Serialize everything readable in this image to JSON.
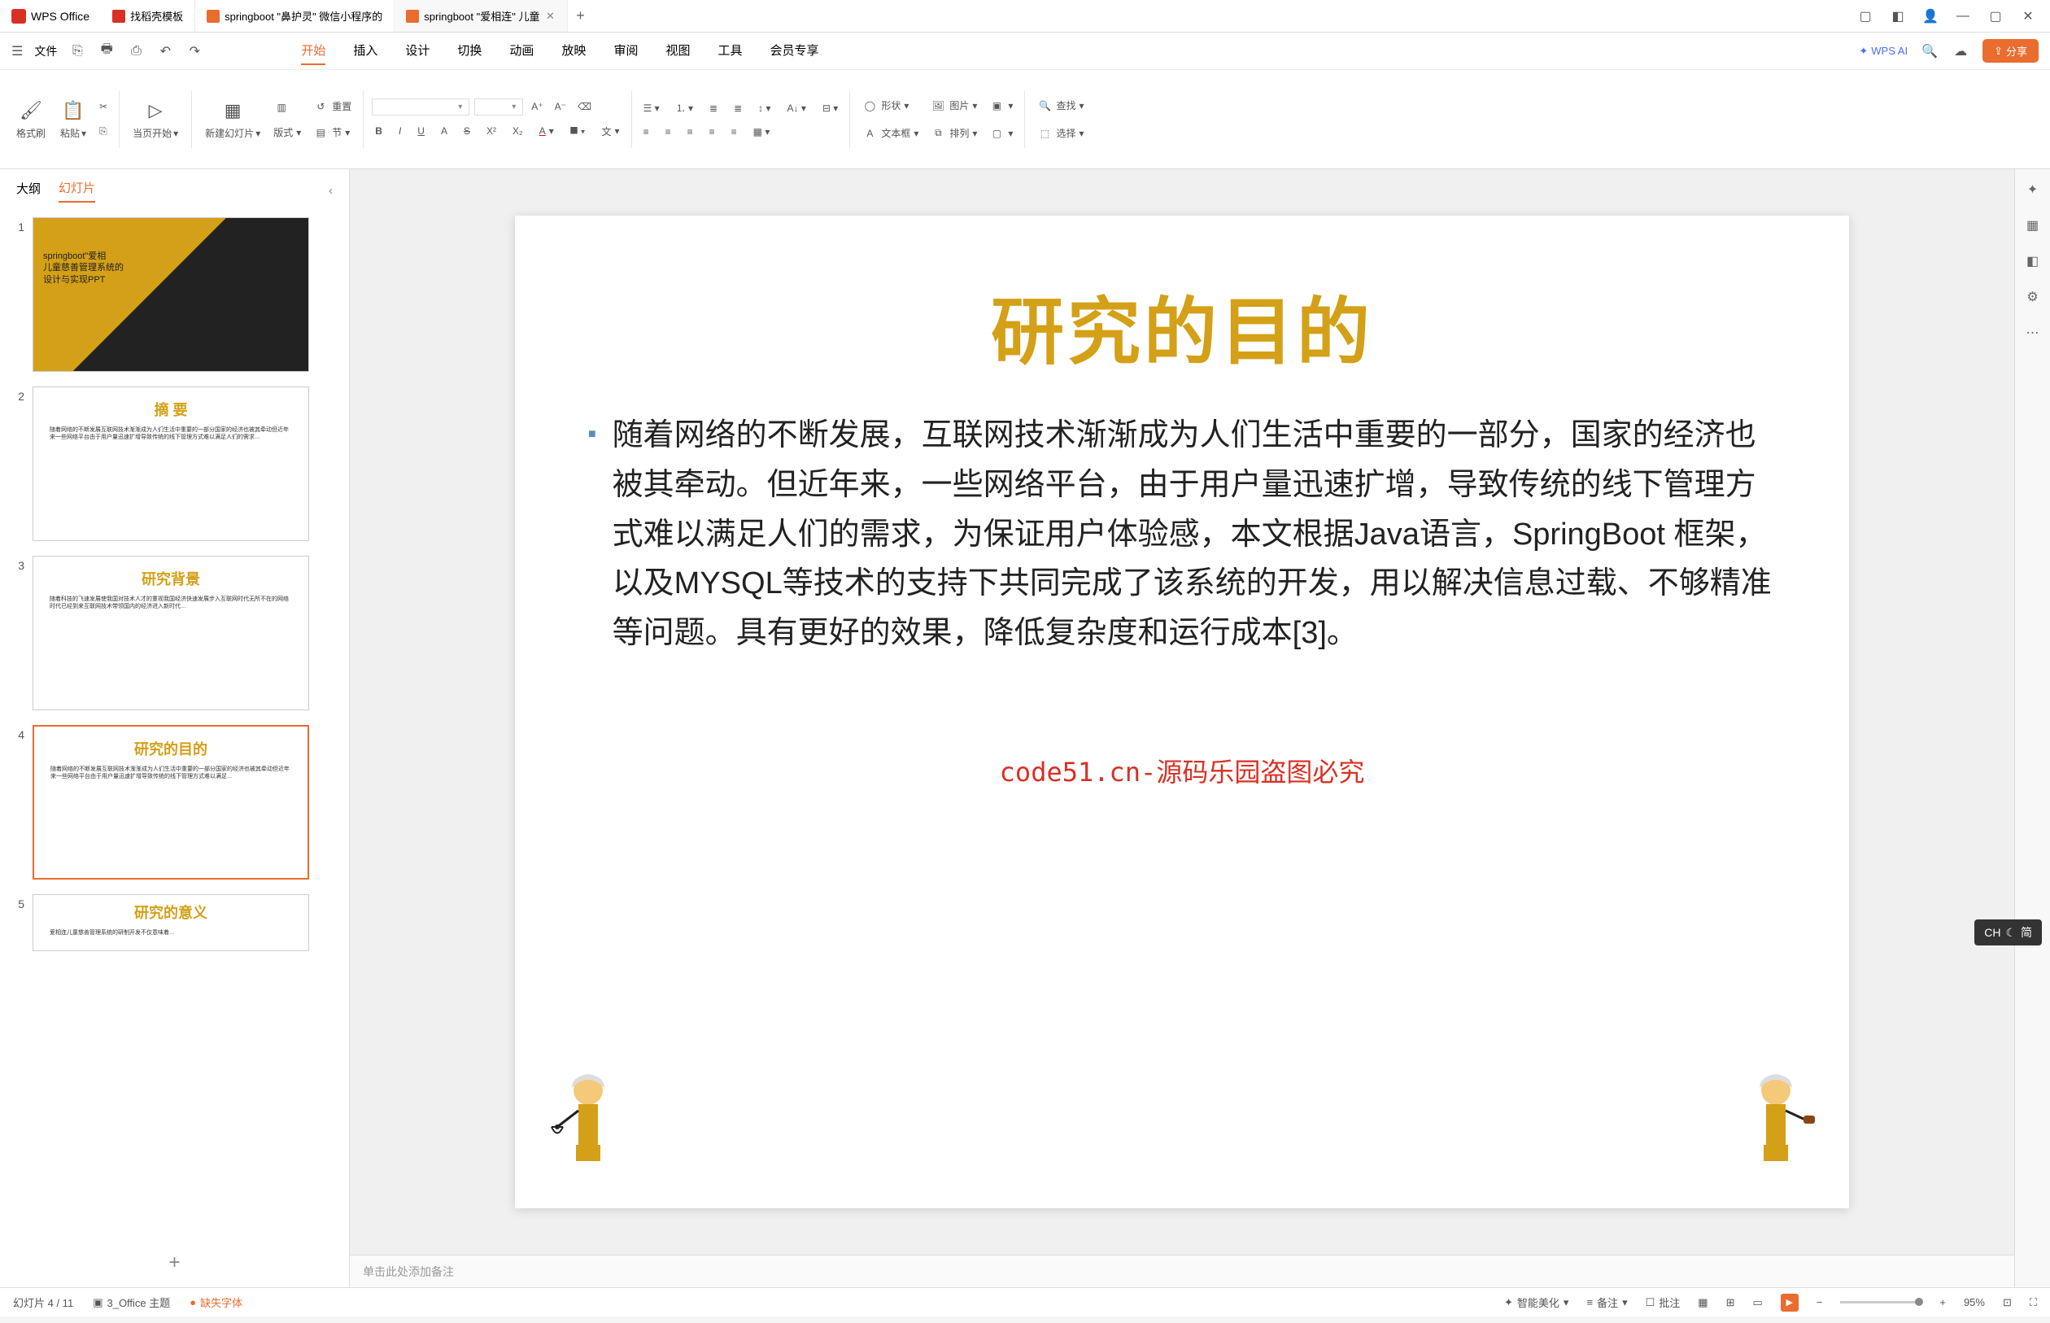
{
  "app": {
    "name": "WPS Office"
  },
  "tabs": [
    {
      "label": "找稻壳模板",
      "icon": "red"
    },
    {
      "label": "springboot \"鼻护灵\" 微信小程序的",
      "icon": "orange"
    },
    {
      "label": "springboot \"爱相连\" 儿童",
      "icon": "orange",
      "active": true
    }
  ],
  "menubar": {
    "file": "文件",
    "tabs": [
      "开始",
      "插入",
      "设计",
      "切换",
      "动画",
      "放映",
      "审阅",
      "视图",
      "工具",
      "会员专享"
    ],
    "active": "开始",
    "wps_ai": "WPS AI",
    "share": "分享"
  },
  "ribbon": {
    "format_brush": "格式刷",
    "paste": "粘贴",
    "current_start": "当页开始",
    "new_slide": "新建幻灯片",
    "layout": "版式",
    "section": "节",
    "reset": "重置",
    "shape": "形状",
    "image": "图片",
    "textbox": "文本框",
    "arrange": "排列",
    "find": "查找",
    "select": "选择",
    "wen": "文"
  },
  "panel": {
    "outline": "大纲",
    "slides": "幻灯片",
    "thumbs": [
      {
        "num": "1",
        "title": "springboot\"爱相\n儿童慈善管理系统的\n设计与实现PPT"
      },
      {
        "num": "2",
        "title": "摘  要"
      },
      {
        "num": "3",
        "title": "研究背景"
      },
      {
        "num": "4",
        "title": "研究的目的",
        "selected": true
      },
      {
        "num": "5",
        "title": "研究的意义"
      }
    ]
  },
  "slide": {
    "title": "研究的目的",
    "body": "随着网络的不断发展，互联网技术渐渐成为人们生活中重要的一部分，国家的经济也被其牵动。但近年来，一些网络平台，由于用户量迅速扩增，导致传统的线下管理方式难以满足人们的需求，为保证用户体验感，本文根据Java语言，SpringBoot 框架，以及MYSQL等技术的支持下共同完成了该系统的开发，用以解决信息过载、不够精准等问题。具有更好的效果，降低复杂度和运行成本[3]。",
    "watermark": "code51.cn-源码乐园盗图必究"
  },
  "notes": {
    "placeholder": "单击此处添加备注"
  },
  "statusbar": {
    "slide_info": "幻灯片 4 / 11",
    "theme": "3_Office 主题",
    "missing_font": "缺失字体",
    "beautify": "智能美化",
    "notes": "备注",
    "comments": "批注",
    "zoom": "95%"
  },
  "ime": {
    "label": "CH",
    "mode": "简"
  },
  "watermark_text": "code51.cn"
}
